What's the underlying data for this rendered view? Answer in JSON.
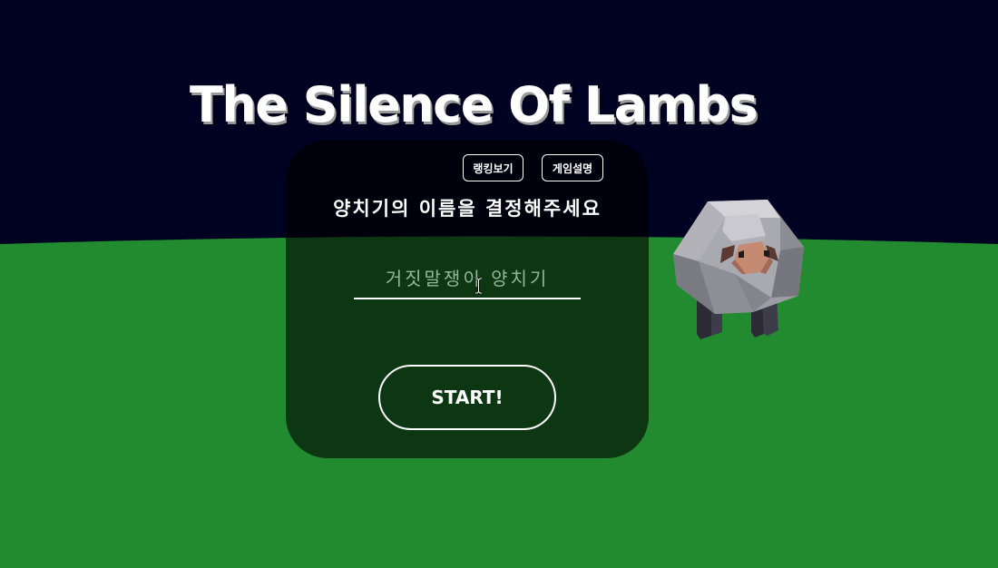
{
  "game": {
    "title": "The Silence Of Lambs",
    "buttons": {
      "ranking": "랭킹보기",
      "guide": "게임설명"
    },
    "prompt": "양치기의 이름을 결정해주세요",
    "name_input": {
      "value": "",
      "placeholder": "거짓말쟁이 양치기"
    },
    "start_label": "START!"
  },
  "colors": {
    "sky": "#000222",
    "grass": "#228b30",
    "panel": "rgba(0,0,0,0.6)",
    "text": "#ffffff"
  },
  "icons": [
    "text-cursor-icon",
    "sheep-character"
  ]
}
